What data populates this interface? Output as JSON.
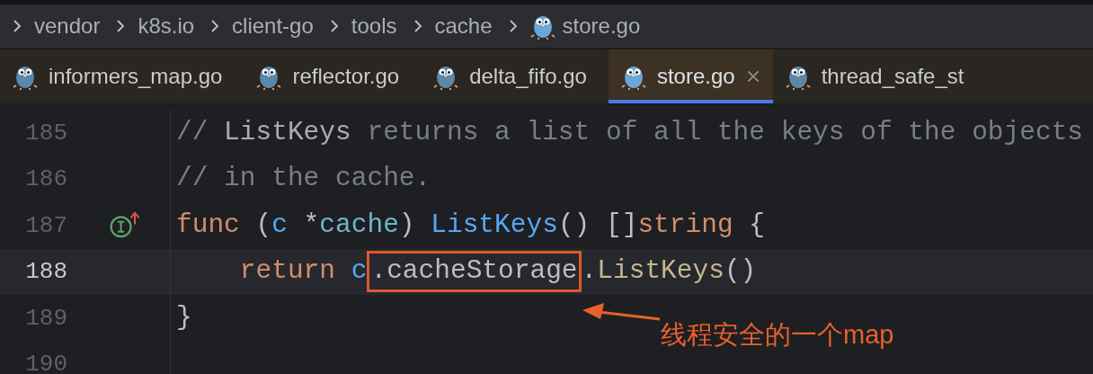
{
  "breadcrumb": [
    {
      "label": "vendor",
      "kind": "folder"
    },
    {
      "label": "k8s.io",
      "kind": "folder"
    },
    {
      "label": "client-go",
      "kind": "folder"
    },
    {
      "label": "tools",
      "kind": "folder"
    },
    {
      "label": "cache",
      "kind": "folder"
    },
    {
      "label": "store.go",
      "kind": "file"
    }
  ],
  "tabs": [
    {
      "label": "informers_map.go",
      "selected": false
    },
    {
      "label": "reflector.go",
      "selected": false
    },
    {
      "label": "delta_fifo.go",
      "selected": false
    },
    {
      "label": "store.go",
      "selected": true
    },
    {
      "label": "thread_safe_st",
      "selected": false
    }
  ],
  "editor": {
    "lines": [
      {
        "number": "185",
        "current": false,
        "implements_marker": false,
        "tokens": [
          {
            "text": "// ",
            "kind": "comment",
            "boxed": false
          },
          {
            "text": "ListKeys",
            "kind": "doc_ref",
            "boxed": false
          },
          {
            "text": " returns a list of all the keys of the objects",
            "kind": "comment",
            "boxed": false
          }
        ]
      },
      {
        "number": "186",
        "current": false,
        "implements_marker": false,
        "tokens": [
          {
            "text": "// in the cache.",
            "kind": "comment",
            "boxed": false
          }
        ]
      },
      {
        "number": "187",
        "current": false,
        "implements_marker": true,
        "tokens": [
          {
            "text": "func",
            "kind": "keyword",
            "boxed": false
          },
          {
            "text": " (",
            "kind": "plain",
            "boxed": false
          },
          {
            "text": "c",
            "kind": "param",
            "boxed": false
          },
          {
            "text": " *",
            "kind": "plain",
            "boxed": false
          },
          {
            "text": "cache",
            "kind": "type",
            "boxed": false
          },
          {
            "text": ") ",
            "kind": "plain",
            "boxed": false
          },
          {
            "text": "ListKeys",
            "kind": "func",
            "boxed": false
          },
          {
            "text": "() []",
            "kind": "plain",
            "boxed": false
          },
          {
            "text": "string",
            "kind": "keyword",
            "boxed": false
          },
          {
            "text": " {",
            "kind": "plain",
            "boxed": false
          }
        ]
      },
      {
        "number": "188",
        "current": true,
        "implements_marker": false,
        "tokens": [
          {
            "text": "    return ",
            "kind": "keyword",
            "boxed": false
          },
          {
            "text": "c",
            "kind": "param",
            "boxed": false
          },
          {
            "text": ".cacheStorage",
            "kind": "plain",
            "boxed": true
          },
          {
            "text": ".",
            "kind": "plain",
            "boxed": false
          },
          {
            "text": "ListKeys",
            "kind": "method",
            "boxed": false
          },
          {
            "text": "()",
            "kind": "plain",
            "boxed": false
          }
        ]
      },
      {
        "number": "189",
        "current": false,
        "implements_marker": false,
        "tokens": [
          {
            "text": "}",
            "kind": "plain",
            "boxed": false
          }
        ]
      },
      {
        "number": "190",
        "current": false,
        "implements_marker": false
      }
    ],
    "annotation": {
      "text": "线程安全的一个map"
    }
  }
}
